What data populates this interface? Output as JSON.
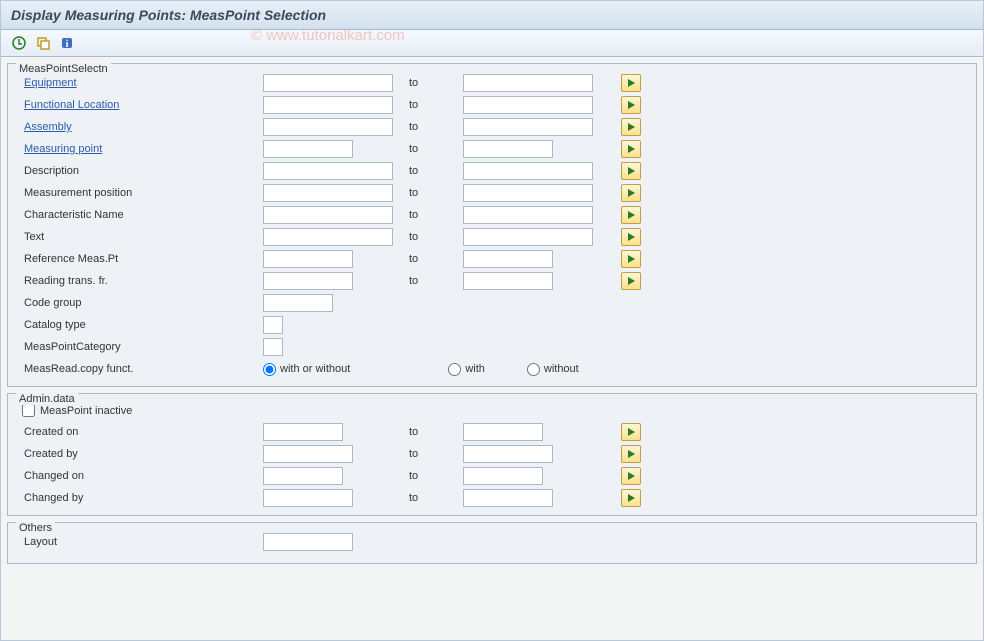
{
  "title": "Display Measuring Points: MeasPoint Selection",
  "watermark": "© www.tutorialkart.com",
  "toolbar": {
    "execute": "⊕",
    "variant": "⎘",
    "info": "ℹ"
  },
  "group1": {
    "legend": "MeasPointSelectn",
    "to_label": "to",
    "rows": {
      "equipment": "Equipment",
      "funcloc": "Functional Location",
      "assembly": "Assembly",
      "measpoint": "Measuring point",
      "description": "Description",
      "measpos": "Measurement position",
      "charname": "Characteristic Name",
      "text": "Text",
      "refmeas": "Reference Meas.Pt",
      "readingtrans": "Reading trans. fr.",
      "codegroup": "Code group",
      "catalogtype": "Catalog type",
      "measpointcat": "MeasPointCategory",
      "measreadcopy": "MeasRead.copy funct."
    },
    "radio": {
      "with_or_without": "with or without",
      "with": "with",
      "without": "without",
      "selected": "with_or_without"
    }
  },
  "group2": {
    "legend": "Admin.data",
    "to_label": "to",
    "checkbox": {
      "label": "MeasPoint inactive",
      "checked": false
    },
    "rows": {
      "createdon": "Created on",
      "createdby": "Created by",
      "changedon": "Changed on",
      "changedby": "Changed by"
    }
  },
  "group3": {
    "legend": "Others",
    "rows": {
      "layout": "Layout"
    }
  }
}
